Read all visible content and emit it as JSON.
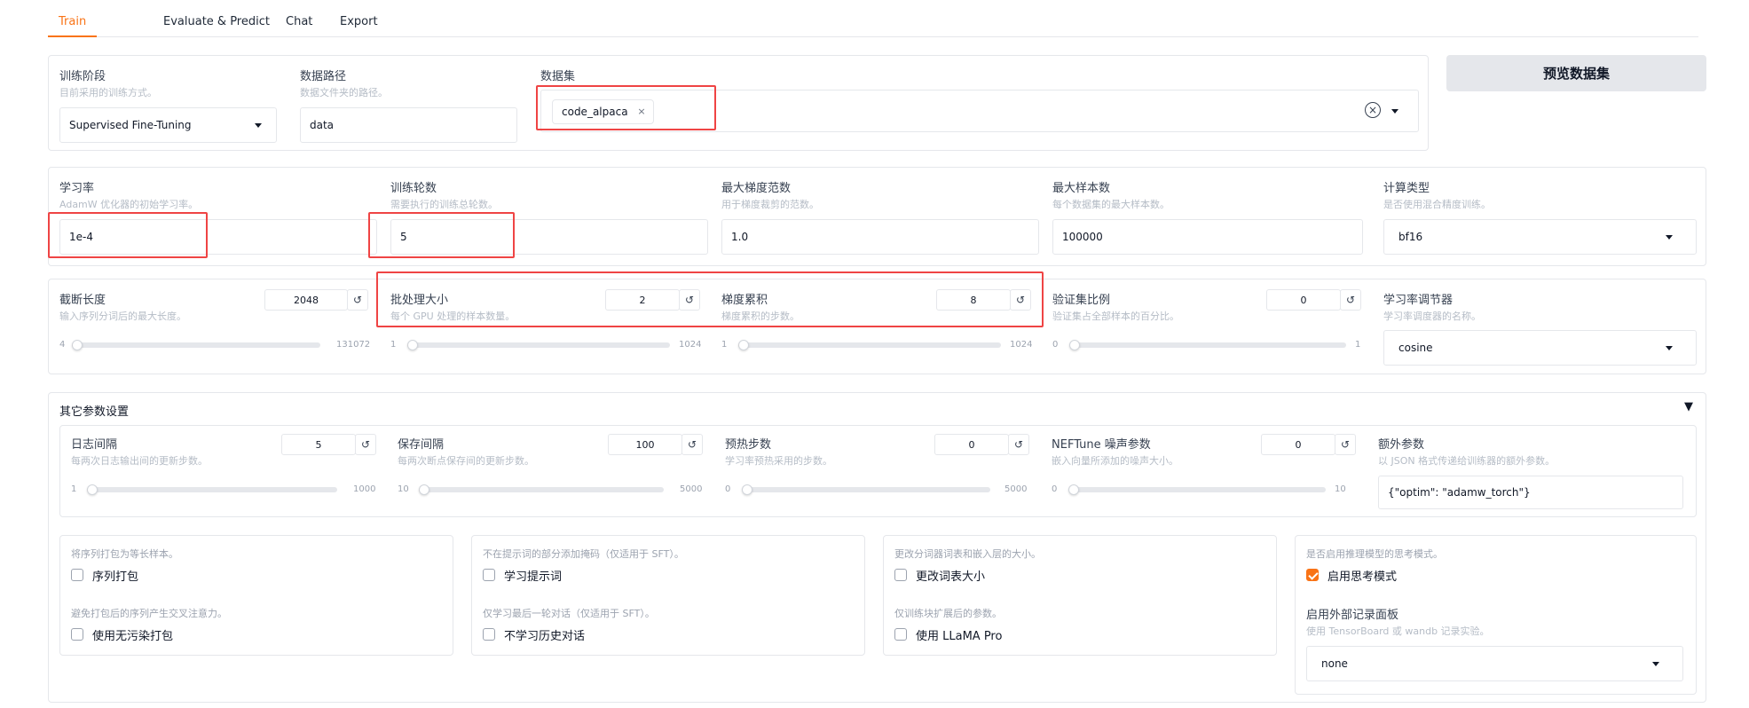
{
  "tabs": [
    "Train",
    "Evaluate & Predict",
    "Chat",
    "Export"
  ],
  "preview_button": "预览数据集",
  "row1": {
    "stage": {
      "label": "训练阶段",
      "info": "目前采用的训练方式。",
      "value": "Supervised Fine-Tuning"
    },
    "data_dir": {
      "label": "数据路径",
      "info": "数据文件夹的路径。",
      "value": "data"
    },
    "dataset": {
      "label": "数据集",
      "tag": "code_alpaca",
      "tag_remove": "×",
      "clear": "×"
    }
  },
  "row2": {
    "learning_rate": {
      "label": "学习率",
      "info": "AdamW 优化器的初始学习率。",
      "value": "1e-4"
    },
    "epochs": {
      "label": "训练轮数",
      "info": "需要执行的训练总轮数。",
      "value": "5"
    },
    "max_grad_norm": {
      "label": "最大梯度范数",
      "info": "用于梯度裁剪的范数。",
      "value": "1.0"
    },
    "max_samples": {
      "label": "最大样本数",
      "info": "每个数据集的最大样本数。",
      "value": "100000"
    },
    "compute_type": {
      "label": "计算类型",
      "info": "是否使用混合精度训练。",
      "value": "bf16"
    }
  },
  "row3": {
    "cutoff": {
      "label": "截断长度",
      "info": "输入序列分词后的最大长度。",
      "value": "2048",
      "min": "4",
      "max": "131072",
      "fraction": 0.0156
    },
    "batch_size": {
      "label": "批处理大小",
      "info": "每个 GPU 处理的样本数量。",
      "value": "2",
      "min": "1",
      "max": "1024",
      "fraction": 0.001
    },
    "grad_accum": {
      "label": "梯度累积",
      "info": "梯度累积的步数。",
      "value": "8",
      "min": "1",
      "max": "1024",
      "fraction": 0.0068
    },
    "val_size": {
      "label": "验证集比例",
      "info": "验证集占全部样本的百分比。",
      "value": "0",
      "min": "0",
      "max": "1",
      "fraction": 0
    },
    "lr_scheduler": {
      "label": "学习率调节器",
      "info": "学习率调度器的名称。",
      "value": "cosine"
    }
  },
  "other": {
    "title": "其它参数设置",
    "toggle": "▼",
    "logging_steps": {
      "label": "日志间隔",
      "info": "每两次日志输出间的更新步数。",
      "value": "5",
      "min": "1",
      "max": "1000",
      "fraction": 0.004
    },
    "save_steps": {
      "label": "保存间隔",
      "info": "每两次断点保存间的更新步数。",
      "value": "100",
      "min": "10",
      "max": "5000",
      "fraction": 0.018
    },
    "warmup_steps": {
      "label": "预热步数",
      "info": "学习率预热采用的步数。",
      "value": "0",
      "min": "0",
      "max": "5000",
      "fraction": 0
    },
    "neftune": {
      "label": "NEFTune 噪声参数",
      "info": "嵌入向量所添加的噪声大小。",
      "value": "0",
      "min": "0",
      "max": "10",
      "fraction": 0
    },
    "extra_args": {
      "label": "额外参数",
      "info": "以 JSON 格式传递给训练器的额外参数。",
      "value": "{\"optim\": \"adamw_torch\"}"
    },
    "packing": {
      "info": "将序列打包为等长样本。",
      "label": "序列打包",
      "checked": false
    },
    "neat_packing": {
      "info": "避免打包后的序列产生交叉注意力。",
      "label": "使用无污染打包",
      "checked": false
    },
    "train_on_prompt": {
      "info": "不在提示词的部分添加掩码（仅适用于 SFT）。",
      "label": "学习提示词",
      "checked": false
    },
    "mask_history": {
      "info": "仅学习最后一轮对话（仅适用于 SFT）。",
      "label": "不学习历史对话",
      "checked": false
    },
    "resize_vocab": {
      "info": "更改分词器词表和嵌入层的大小。",
      "label": "更改词表大小",
      "checked": false
    },
    "use_llama_pro": {
      "info": "仅训练块扩展后的参数。",
      "label": "使用 LLaMA Pro",
      "checked": false
    },
    "enable_thinking": {
      "info": "是否启用推理模型的思考模式。",
      "label": "启用思考模式",
      "checked": true
    },
    "report_to": {
      "label": "启用外部记录面板",
      "info": "使用 TensorBoard 或 wandb 记录实验。",
      "value": "none"
    }
  },
  "icons": {
    "reset": "↺",
    "dropdown": "chevron-down-icon"
  },
  "colors": {
    "accent": "#f97316",
    "highlight": "#ef4444"
  }
}
